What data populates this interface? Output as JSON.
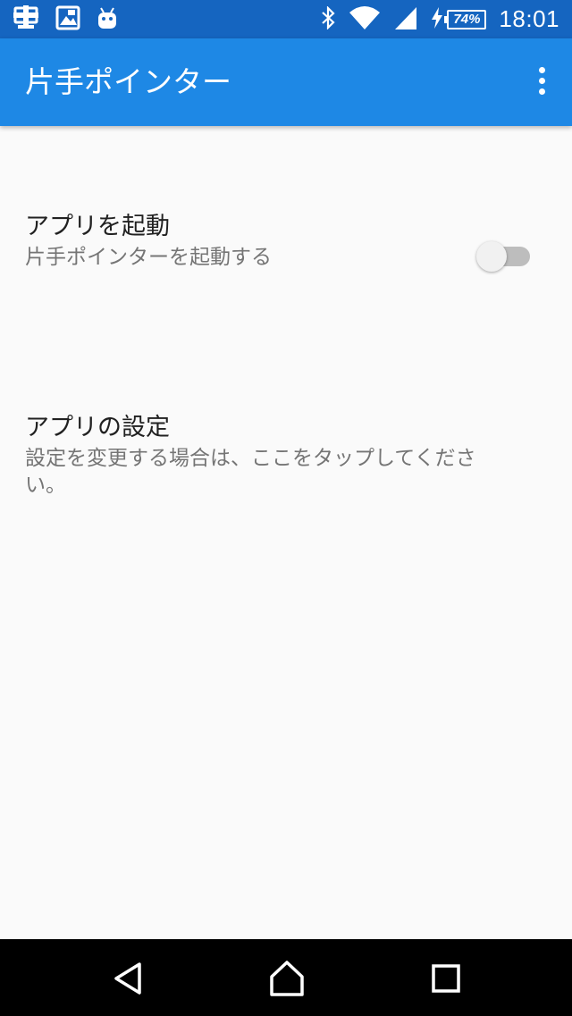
{
  "status_bar": {
    "time": "18:01",
    "battery_percent": "74%",
    "icons_left": [
      "first-aid-notification-icon",
      "image-notification-icon",
      "android-robot-icon"
    ],
    "icons_right": [
      "bluetooth-icon",
      "wifi-icon",
      "cellular-signal-icon",
      "charging-bolt-icon",
      "battery-icon"
    ]
  },
  "app_bar": {
    "title": "片手ポインター",
    "menu_icon": "overflow-menu-icon"
  },
  "preferences": [
    {
      "title": "アプリを起動",
      "summary": "片手ポインターを起動する",
      "toggle_on": false
    },
    {
      "title": "アプリの設定",
      "summary": "設定を変更する場合は、ここをタップしてくださ",
      "summary_line2": "い。"
    }
  ],
  "nav_bar": {
    "buttons": [
      "back-icon",
      "home-icon",
      "recents-icon"
    ]
  },
  "colors": {
    "status_bar": "#1565c0",
    "app_bar": "#1e88e5",
    "background": "#fafafa",
    "nav_bar": "#000000"
  }
}
